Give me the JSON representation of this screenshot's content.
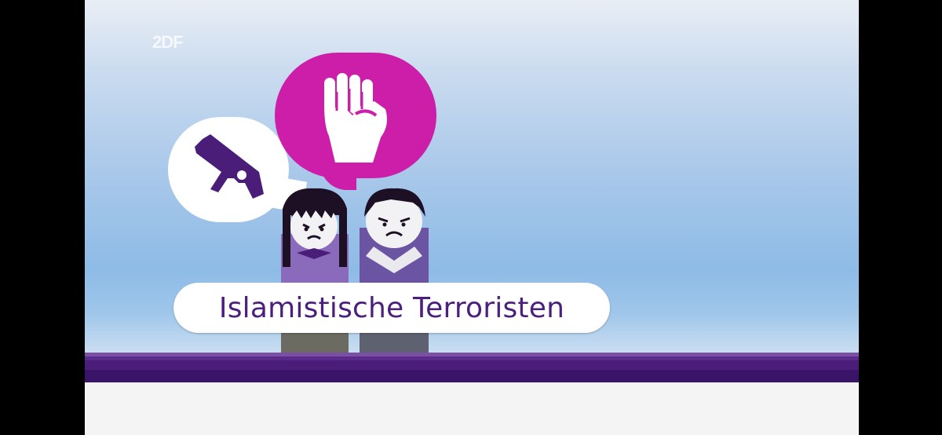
{
  "logo": {
    "text": "2DF"
  },
  "caption": {
    "text": "Islamistische Terroristen"
  },
  "icons": {
    "left_bubble": "gun-icon",
    "right_bubble": "fist-icon"
  },
  "colors": {
    "caption_text": "#4b1f7d",
    "fist_bubble": "#cc1ea8",
    "figure_body_left": "#8a6bbb",
    "figure_body_right": "#6b54a2",
    "floor": "#4a1d78"
  }
}
